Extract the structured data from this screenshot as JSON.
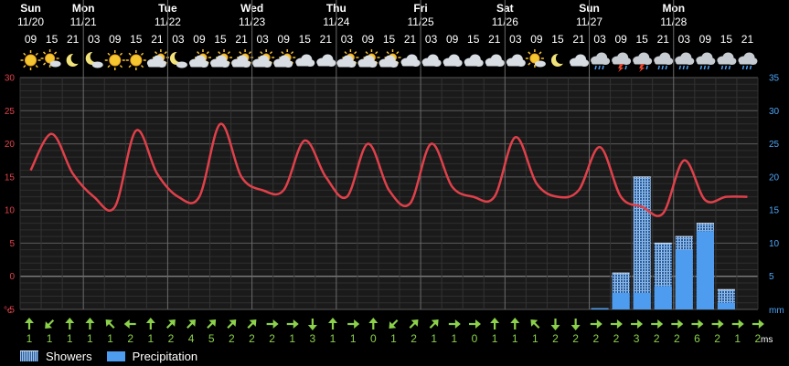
{
  "days": [
    {
      "name": "Sun",
      "date": "11/20"
    },
    {
      "name": "Mon",
      "date": "11/21"
    },
    {
      "name": "Tue",
      "date": "11/22"
    },
    {
      "name": "Wed",
      "date": "11/23"
    },
    {
      "name": "Thu",
      "date": "11/24"
    },
    {
      "name": "Fri",
      "date": "11/25"
    },
    {
      "name": "Sat",
      "date": "11/26"
    },
    {
      "name": "Sun",
      "date": "11/27"
    },
    {
      "name": "Mon",
      "date": "11/28"
    }
  ],
  "hours": [
    "09",
    "15",
    "21",
    "03",
    "09",
    "15",
    "21",
    "03",
    "09",
    "15",
    "21",
    "03",
    "09",
    "15",
    "21",
    "03",
    "09",
    "15",
    "21",
    "03",
    "09",
    "15",
    "21",
    "03",
    "09",
    "15",
    "21",
    "03",
    "09",
    "15",
    "21",
    "03",
    "09",
    "15",
    "21"
  ],
  "icons": [
    "sun",
    "partly-sunny",
    "moon",
    "moon-cloud",
    "sun",
    "sun",
    "cloud-sun",
    "moon-cloud",
    "cloud-sun",
    "cloud-sun",
    "cloud-sun",
    "cloud-sun",
    "cloud-sun",
    "cloud",
    "cloud",
    "cloud-sun",
    "cloud-sun",
    "cloud-sun",
    "cloud",
    "cloud",
    "cloud",
    "cloud",
    "cloud",
    "cloud",
    "partly-sunny",
    "moon",
    "cloud",
    "cloud-rain",
    "cloud-thunder",
    "cloud-thunder",
    "cloud-rain",
    "cloud-rain",
    "cloud-rain",
    "cloud-rain",
    "cloud-rain"
  ],
  "wind": {
    "unit": "ms",
    "speeds": [
      "1",
      "1",
      "1",
      "1",
      "1",
      "2",
      "1",
      "2",
      "4",
      "5",
      "2",
      "2",
      "2",
      "1",
      "3",
      "1",
      "1",
      "0",
      "1",
      "2",
      "1",
      "1",
      "0",
      "1",
      "1",
      "1",
      "2",
      "2",
      "2",
      "2",
      "3",
      "2",
      "2",
      "6",
      "2",
      "1",
      "2"
    ],
    "directions": [
      "up",
      "down-left",
      "up",
      "up",
      "up-left",
      "left",
      "up",
      "up-right",
      "up-right",
      "up-right",
      "up-right",
      "up-right",
      "right",
      "right",
      "down",
      "up",
      "right",
      "up",
      "down-left",
      "up-right",
      "up-right",
      "right",
      "right",
      "up",
      "up",
      "up-left",
      "down",
      "down",
      "right",
      "right",
      "right",
      "right",
      "right",
      "right",
      "right",
      "right",
      "right"
    ]
  },
  "legend": {
    "showers": "Showers",
    "precipitation": "Precipitation"
  },
  "chart_data": {
    "type": "line",
    "x_labels": [
      "09",
      "15",
      "21",
      "03",
      "09",
      "15",
      "21",
      "03",
      "09",
      "15",
      "21",
      "03",
      "09",
      "15",
      "21",
      "03",
      "09",
      "15",
      "21",
      "03",
      "09",
      "15",
      "21",
      "03",
      "09",
      "15",
      "21",
      "03",
      "09",
      "15",
      "21",
      "03",
      "09",
      "15",
      "21"
    ],
    "left_axis": {
      "unit": "°c",
      "ylim": [
        -5,
        30
      ],
      "ticks": [
        30,
        25,
        20,
        15,
        10,
        5,
        0,
        -5
      ]
    },
    "right_axis": {
      "unit": "mm",
      "ylim": [
        0,
        35
      ],
      "ticks": [
        35,
        30,
        25,
        20,
        15,
        10,
        5
      ]
    },
    "series": [
      {
        "name": "Temperature",
        "color": "#e0404a",
        "values": [
          16,
          21.5,
          15.5,
          12,
          10.5,
          22,
          15.5,
          12,
          12,
          23,
          15,
          13,
          13,
          20.5,
          15,
          12,
          20,
          13,
          11,
          20,
          13.5,
          12,
          12,
          21,
          14,
          12,
          13,
          19.5,
          12,
          10.5,
          9.5,
          17.5,
          11.5,
          12,
          12
        ]
      },
      {
        "name": "Showers",
        "color": "#8ab8ec",
        "values": [
          0,
          0,
          0,
          0,
          0,
          0,
          0,
          0,
          0,
          0,
          0,
          0,
          0,
          0,
          0,
          0,
          0,
          0,
          0,
          0,
          0,
          0,
          0,
          0,
          0,
          0,
          0,
          0,
          5.5,
          20,
          10,
          11,
          13,
          3,
          0
        ]
      },
      {
        "name": "Precipitation",
        "color": "#4e9cf0",
        "values": [
          0,
          0,
          0,
          0,
          0,
          0,
          0,
          0,
          0,
          0,
          0,
          0,
          0,
          0,
          0,
          0,
          0,
          0,
          0,
          0,
          0,
          0,
          0,
          0,
          0,
          0,
          0,
          0.2,
          2.5,
          2.5,
          3.5,
          9,
          11.8,
          1,
          0
        ]
      }
    ],
    "grid": true
  }
}
